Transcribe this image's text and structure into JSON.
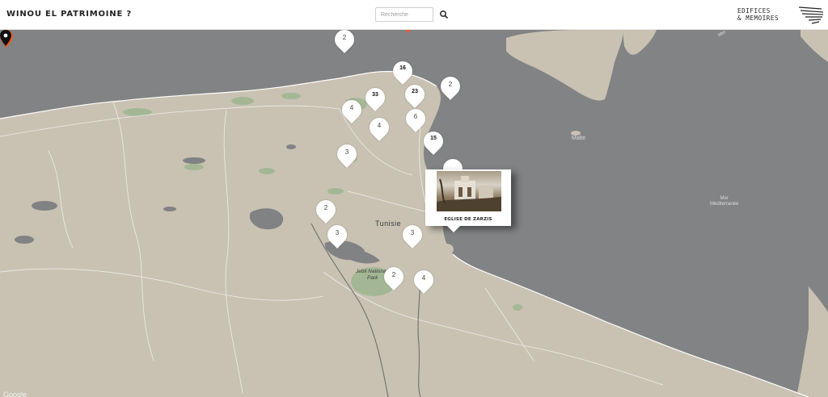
{
  "header": {
    "app_title": "WINOU EL PATRIMOINE ?",
    "search_placeholder": "Recherche",
    "brand_line1": "EDIFICES",
    "brand_line2": "& MEMOIRES"
  },
  "map": {
    "colors": {
      "sea": "#818384",
      "land": "#c9c2b3",
      "accent_marker": "#f05a23"
    },
    "clusters": [
      {
        "count": "2"
      },
      {
        "count": "16"
      },
      {
        "count": "33"
      },
      {
        "count": "23"
      },
      {
        "count": "2"
      },
      {
        "count": "4"
      },
      {
        "count": "6"
      },
      {
        "count": "4"
      },
      {
        "count": "15"
      },
      {
        "count": "3"
      },
      {
        "count": "2"
      },
      {
        "count": "3"
      },
      {
        "count": "3"
      },
      {
        "count": "2"
      },
      {
        "count": "4"
      }
    ],
    "popup": {
      "title": "EGLISE DE ZARZIS"
    },
    "labels": {
      "country": "Tunisie",
      "park_line1": "Jebil National",
      "park_line2": "Park",
      "malta": "Malte",
      "sea_line1": "Mer",
      "sea_line2": "Méditerranée",
      "sea_top": "Mer"
    },
    "attribution": "Google"
  }
}
